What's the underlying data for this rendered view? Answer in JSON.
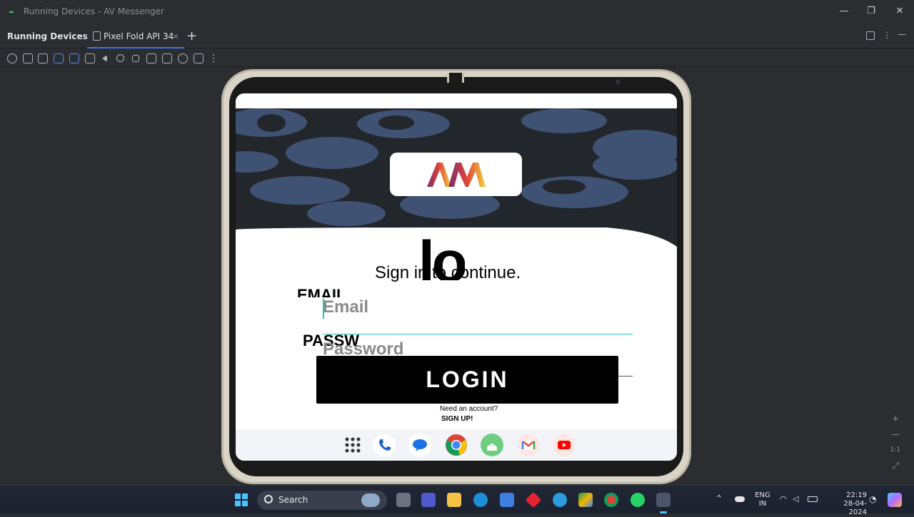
{
  "window": {
    "title": "Running Devices - AV Messenger",
    "minimize": "—",
    "restore": "❐",
    "close": "✕"
  },
  "panel": {
    "header": "Running Devices",
    "tab_label": "Pixel Fold API 34",
    "tab_close": "×",
    "add_tab": "+"
  },
  "toolbar": {
    "more": "⋮",
    "icons": [
      "power-icon",
      "volume-up-icon",
      "volume-down-icon",
      "rotate-left-icon",
      "fold-icon",
      "unfold-icon",
      "back-icon",
      "home-icon",
      "overview-icon",
      "screenshot-icon",
      "record-icon",
      "reset-icon",
      "display-icon",
      "more-icon"
    ]
  },
  "side_controls": {
    "zoom_in": "+",
    "zoom_out": "—",
    "actual_size": "1:1",
    "fit": "⤢"
  },
  "app": {
    "logo_text": "AM",
    "headline_fragment": "lo",
    "subtitle": "Sign in to continue.",
    "email_label": "EMAIL",
    "email_placeholder": "Email",
    "password_label": "PASSW",
    "password_placeholder": "Password",
    "login_button": "LOGIN",
    "need_account": "Need an account?",
    "sign_up": "SIGN UP!",
    "colors": {
      "accent": "#19c6b6",
      "hero_bg": "#23262b",
      "hero_blob": "#3f5273",
      "button_bg": "#000000"
    }
  },
  "dock": {
    "apps": [
      "apps-grid-icon",
      "phone-icon",
      "messages-icon",
      "chrome-icon",
      "android-icon",
      "gmail-icon",
      "youtube-icon"
    ]
  },
  "taskbar": {
    "search_label": "Search",
    "lang_top": "ENG",
    "lang_bottom": "IN",
    "time": "22:19",
    "date": "28-04-2024"
  }
}
